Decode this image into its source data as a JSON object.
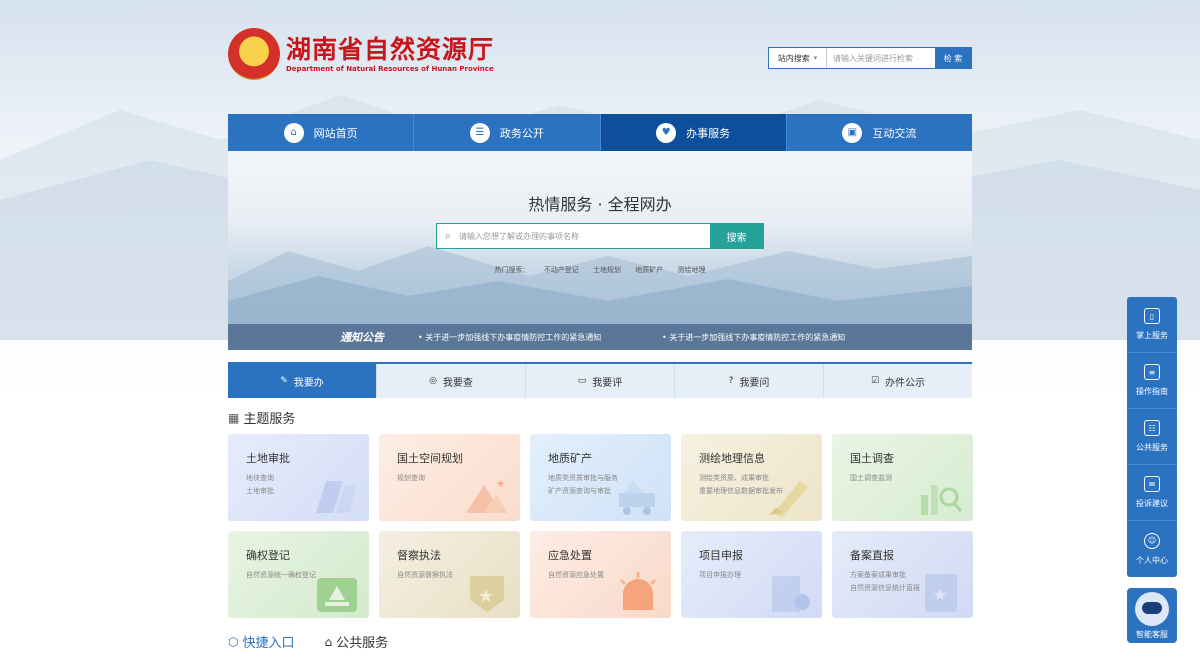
{
  "header": {
    "title": "湖南省自然资源厅",
    "subtitle": "Department of Natural Resources of Hunan Province"
  },
  "site_search": {
    "scope": "站内搜索",
    "placeholder": "请输入关键词进行检索",
    "button": "检 索"
  },
  "nav": [
    {
      "label": "网站首页",
      "icon": "home-icon"
    },
    {
      "label": "政务公开",
      "icon": "document-icon"
    },
    {
      "label": "办事服务",
      "icon": "handshake-icon",
      "active": true
    },
    {
      "label": "互动交流",
      "icon": "chat-icon"
    }
  ],
  "hero": {
    "title": "热情服务 · 全程网办",
    "placeholder": "请输入您想了解或办理的事项名称",
    "button": "搜索",
    "hot_label": "热门搜索：",
    "hot_items": [
      "不动产登记",
      "土地规划",
      "地质矿产",
      "测绘地理"
    ]
  },
  "notice": {
    "label": "通知公告",
    "items": [
      "关于进一步加强线下办事疫情防控工作的紧急通知",
      "关于进一步加强线下办事疫情防控工作的紧急通知"
    ]
  },
  "tabs": [
    {
      "label": "我要办",
      "icon": "pen-icon",
      "active": true
    },
    {
      "label": "我要查",
      "icon": "search-shield-icon"
    },
    {
      "label": "我要评",
      "icon": "comment-icon"
    },
    {
      "label": "我要问",
      "icon": "question-icon"
    },
    {
      "label": "办件公示",
      "icon": "clipboard-icon"
    }
  ],
  "section": {
    "title": "主题服务"
  },
  "cards": [
    {
      "title": "土地审批",
      "lines": [
        "地块查询",
        "土地审批"
      ]
    },
    {
      "title": "国土空间规划",
      "lines": [
        "规划查询"
      ]
    },
    {
      "title": "地质矿产",
      "lines": [
        "地质类资质审批与服务",
        "矿产资源查询与审批"
      ]
    },
    {
      "title": "测绘地理信息",
      "lines": [
        "测绘类资质、成果审批",
        "重要地理信息数据审批发布"
      ]
    },
    {
      "title": "国土调查",
      "lines": [
        "国土调查监测"
      ]
    },
    {
      "title": "确权登记",
      "lines": [
        "自然资源统一确权登记"
      ]
    },
    {
      "title": "督察执法",
      "lines": [
        "自然资源督察执法"
      ]
    },
    {
      "title": "应急处置",
      "lines": [
        "自然资源应急处置"
      ]
    },
    {
      "title": "项目申报",
      "lines": [
        "项目申报办理"
      ]
    },
    {
      "title": "备案直报",
      "lines": [
        "方案备案成果审批",
        "自然资源信息统计直报"
      ]
    }
  ],
  "bottom_tabs": [
    {
      "label": "快捷入口",
      "active": true
    },
    {
      "label": "公共服务"
    }
  ],
  "sidebar": [
    {
      "label": "掌上服务",
      "icon": "phone-icon"
    },
    {
      "label": "操作指南",
      "icon": "book-icon"
    },
    {
      "label": "公共服务",
      "icon": "people-icon"
    },
    {
      "label": "投诉建议",
      "icon": "complaint-icon"
    },
    {
      "label": "个人中心",
      "icon": "user-icon"
    }
  ],
  "assistant": {
    "label": "智能客服"
  }
}
